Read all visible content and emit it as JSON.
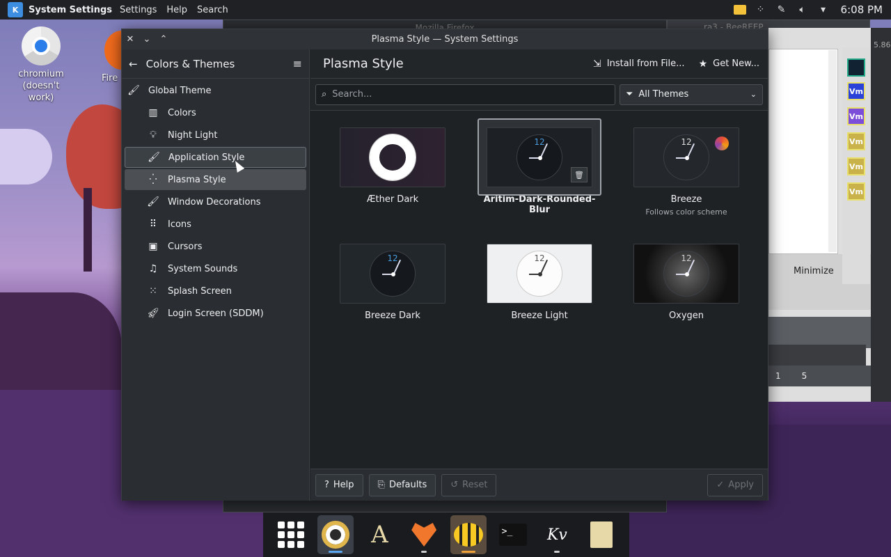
{
  "topbar": {
    "app_name": "System Settings",
    "menus": [
      "Settings",
      "Help",
      "Search"
    ],
    "clock": "6:08 PM",
    "tray_icons": [
      "folder-icon",
      "network-icon",
      "pen-icon",
      "volume-icon",
      "arrow-down-icon"
    ]
  },
  "desktop": {
    "icons": [
      {
        "label": "chromium (doesn't work)"
      },
      {
        "label": "Fire"
      }
    ]
  },
  "background_window": {
    "title": "Mozilla Firefox",
    "right_title": "…ra3 - BeeREEP",
    "minimize_label": "Minimize",
    "status_a": "1",
    "status_b": "5",
    "side_label": "5.86"
  },
  "window": {
    "title": "Plasma Style — System Settings",
    "sidebar": {
      "header": "Colors & Themes",
      "items": [
        {
          "label": "Global Theme",
          "icon": "brush-icon"
        },
        {
          "label": "Colors",
          "icon": "palette-icon"
        },
        {
          "label": "Night Light",
          "icon": "bulb-icon"
        },
        {
          "label": "Application Style",
          "icon": "brush-icon"
        },
        {
          "label": "Plasma Style",
          "icon": "dots-icon"
        },
        {
          "label": "Window Decorations",
          "icon": "brush-icon"
        },
        {
          "label": "Icons",
          "icon": "grid-icon"
        },
        {
          "label": "Cursors",
          "icon": "cursor-box-icon"
        },
        {
          "label": "System Sounds",
          "icon": "music-icon"
        },
        {
          "label": "Splash Screen",
          "icon": "spinner-icon"
        },
        {
          "label": "Login Screen (SDDM)",
          "icon": "rocket-icon"
        }
      ]
    },
    "content": {
      "title": "Plasma Style",
      "install_label": "Install from File...",
      "get_new_label": "Get New...",
      "search_placeholder": "Search...",
      "filter_label": "All Themes",
      "themes": [
        {
          "name": "Æther Dark",
          "subtitle": ""
        },
        {
          "name": "Aritim-Dark-Rounded-Blur",
          "subtitle": ""
        },
        {
          "name": "Breeze",
          "subtitle": "Follows color scheme"
        },
        {
          "name": "Breeze Dark",
          "subtitle": ""
        },
        {
          "name": "Breeze Light",
          "subtitle": ""
        },
        {
          "name": "Oxygen",
          "subtitle": ""
        }
      ],
      "clock_number": "12",
      "footer": {
        "help": "Help",
        "defaults": "Defaults",
        "reset": "Reset",
        "apply": "Apply"
      }
    }
  },
  "dock": {
    "vm_label": "Vm",
    "kv_label": "Kv",
    "term_label": ">_"
  }
}
